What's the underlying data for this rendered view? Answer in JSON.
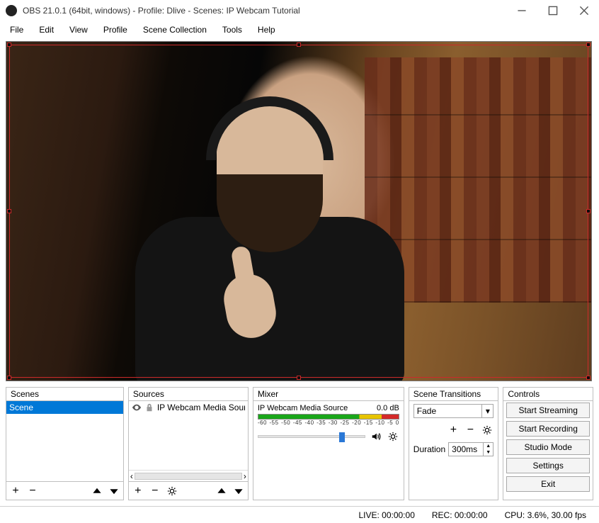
{
  "titlebar": {
    "title": "OBS 21.0.1 (64bit, windows) - Profile: Dlive - Scenes: IP Webcam Tutorial"
  },
  "menu": {
    "file": "File",
    "edit": "Edit",
    "view": "View",
    "profile": "Profile",
    "scene_collection": "Scene Collection",
    "tools": "Tools",
    "help": "Help"
  },
  "panels": {
    "scenes": {
      "title": "Scenes",
      "items": [
        "Scene"
      ]
    },
    "sources": {
      "title": "Sources",
      "items": [
        "IP Webcam Media Source"
      ]
    },
    "mixer": {
      "title": "Mixer",
      "source_name": "IP Webcam Media Source",
      "level": "0.0 dB",
      "ticks": [
        "-60",
        "-55",
        "-50",
        "-45",
        "-40",
        "-35",
        "-30",
        "-25",
        "-20",
        "-15",
        "-10",
        "-5",
        "0"
      ]
    },
    "transitions": {
      "title": "Scene Transitions",
      "selected": "Fade",
      "duration_label": "Duration",
      "duration_value": "300ms"
    },
    "controls": {
      "title": "Controls",
      "start_streaming": "Start Streaming",
      "start_recording": "Start Recording",
      "studio_mode": "Studio Mode",
      "settings": "Settings",
      "exit": "Exit"
    }
  },
  "status": {
    "live": "LIVE: 00:00:00",
    "rec": "REC: 00:00:00",
    "cpu": "CPU: 3.6%, 30.00 fps"
  }
}
